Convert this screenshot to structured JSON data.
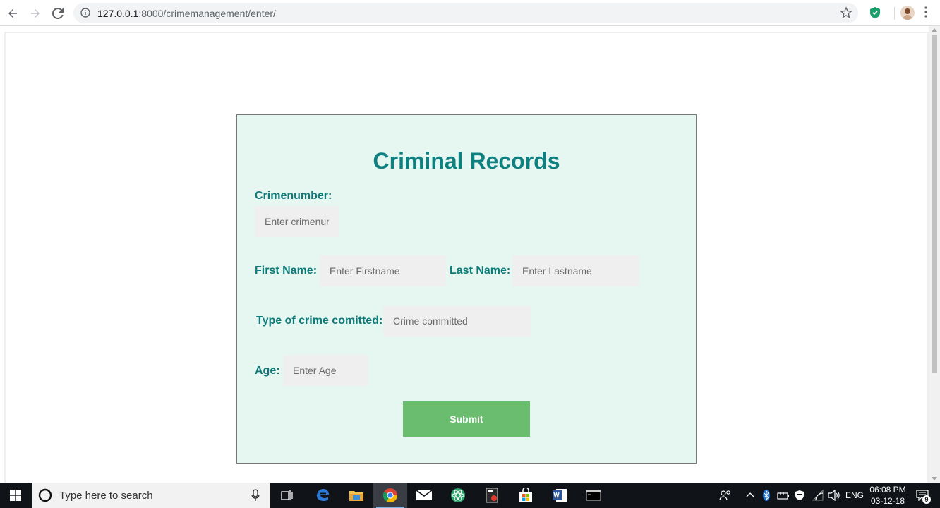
{
  "browser": {
    "url_host": "127.0.0.1",
    "url_rest": ":8000/crimemanagement/enter/"
  },
  "form": {
    "title": "Criminal Records",
    "crimenumber_label": "Crimenumber:",
    "crimenumber_placeholder": "Enter crimenumber",
    "firstname_label": "First Name:",
    "firstname_placeholder": "Enter Firstname",
    "lastname_label": "Last Name:",
    "lastname_placeholder": "Enter Lastname",
    "crime_label": "Type of crime comitted:",
    "crime_placeholder": "Crime committed",
    "age_label": "Age:",
    "age_placeholder": "Enter Age",
    "submit_label": "Submit"
  },
  "taskbar": {
    "search_placeholder": "Type here to search",
    "language": "ENG",
    "time": "06:08 PM",
    "date": "03-12-18",
    "notification_count": "9"
  },
  "colors": {
    "title": "#0f8080",
    "card_bg": "#e6f6f1",
    "submit_bg": "#6abd6e"
  }
}
